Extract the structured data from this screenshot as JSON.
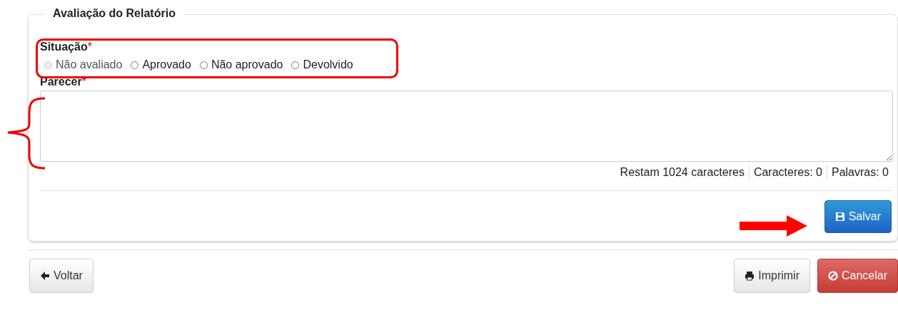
{
  "section": {
    "title": "Avaliação do Relatório"
  },
  "situacao": {
    "label": "Situação",
    "required_mark": "*",
    "options": [
      {
        "label": "Não avaliado",
        "selected": false,
        "disabled": true
      },
      {
        "label": "Aprovado",
        "selected": false,
        "disabled": false
      },
      {
        "label": "Não aprovado",
        "selected": false,
        "disabled": false
      },
      {
        "label": "Devolvido",
        "selected": false,
        "disabled": false
      }
    ]
  },
  "parecer": {
    "label": "Parecer",
    "required_mark": "*",
    "counters": [
      "Restam 1024 caracteres",
      "Caracteres: 0",
      "Palavras: 0"
    ]
  },
  "save_button": "Salvar",
  "footer": {
    "back_button": "Voltar",
    "print_button": "Imprimir",
    "cancel_button": "Cancelar"
  }
}
